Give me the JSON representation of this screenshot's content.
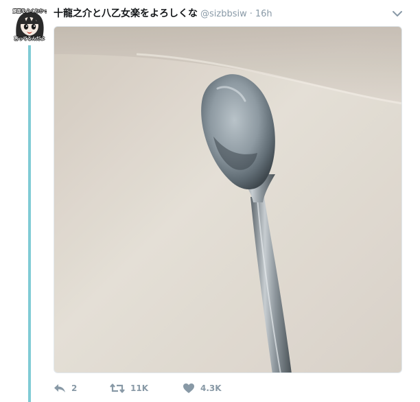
{
  "tweet": {
    "avatar": {
      "caption_top": "顔面をよくわかって",
      "caption_bottom": "言ってるんだよ"
    },
    "display_name": "十龍之介と八乙女楽をよろしくな",
    "handle": "@sizbbsiw",
    "separator": "·",
    "time": "16h",
    "image": {
      "icon": "spoon-photo",
      "colors": {
        "wall": "#ddd6cc",
        "spoon": "#9aa3ab"
      }
    },
    "actions": {
      "reply": {
        "icon": "reply-icon",
        "count": "2"
      },
      "retweet": {
        "icon": "retweet-icon",
        "count": "11K"
      },
      "like": {
        "icon": "heart-icon",
        "count": "4.3K"
      }
    }
  }
}
